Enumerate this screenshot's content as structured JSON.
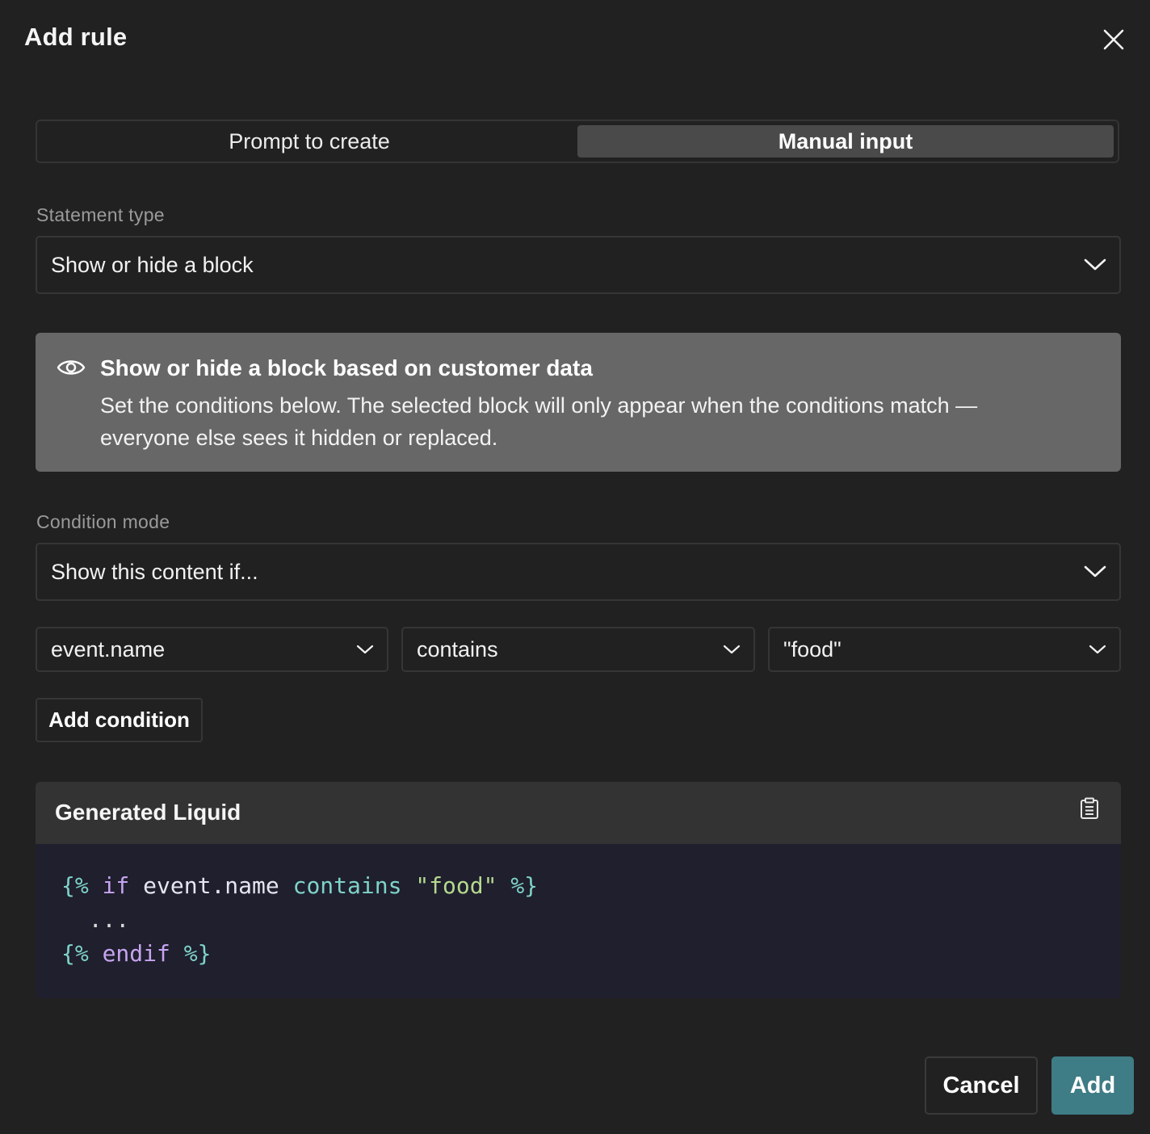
{
  "dialog": {
    "title": "Add rule",
    "close_icon": "close-icon"
  },
  "mode_tabs": [
    {
      "label": "Prompt to create",
      "active": false
    },
    {
      "label": "Manual input",
      "active": true
    }
  ],
  "statement_type": {
    "label": "Statement type",
    "value": "Show or hide a block"
  },
  "info": {
    "icon": "eye-icon",
    "title": "Show or hide a block based on customer data",
    "text": "Set the conditions below. The selected block will only appear when the conditions match — everyone else sees it hidden or replaced."
  },
  "condition_mode": {
    "label": "Condition mode",
    "value": "Show this content if..."
  },
  "condition": {
    "field": "event.name",
    "operator": "contains",
    "value": "\"food\""
  },
  "add_condition_label": "Add condition",
  "generated": {
    "title": "Generated Liquid",
    "copy_icon": "clipboard-icon",
    "code": {
      "line1": {
        "open": "{%",
        "keyword": "if",
        "variable": "event.name",
        "operator": "contains",
        "string": "\"food\"",
        "close": "%}"
      },
      "line2": "...",
      "line3": {
        "open": "{%",
        "keyword": "endif",
        "close": "%}"
      }
    }
  },
  "footer": {
    "cancel_label": "Cancel",
    "add_label": "Add"
  },
  "colors": {
    "background": "#212121",
    "accent": "#3e7c86",
    "info_box": "#676767",
    "code_background": "#1f1f2e"
  }
}
